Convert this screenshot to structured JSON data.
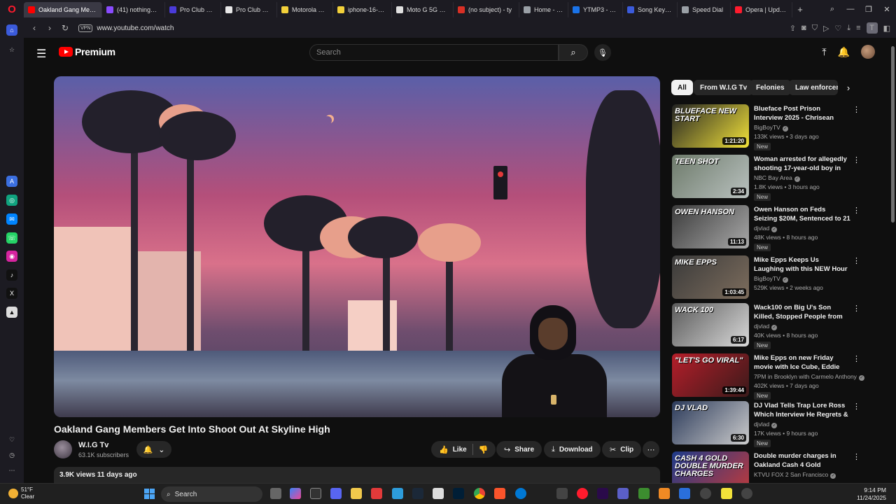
{
  "browser": {
    "tabs": [
      {
        "label": "Oakland Gang Memb",
        "color": "#ff0000",
        "active": true
      },
      {
        "label": "(41) nothingb4ik",
        "color": "#8a4bff"
      },
      {
        "label": "Pro Club Men's",
        "color": "#4a3bd9"
      },
      {
        "label": "Pro Club Men's",
        "color": "#e8e8e8"
      },
      {
        "label": "Motorola moto",
        "color": "#f2d03a"
      },
      {
        "label": "iphone-16-savin",
        "color": "#f2d03a"
      },
      {
        "label": "Moto G 5G NFC",
        "color": "#e0e0e0"
      },
      {
        "label": "(no subject) - ty",
        "color": "#d93025"
      },
      {
        "label": "Home - Google",
        "color": "#9aa0a6"
      },
      {
        "label": "YTMP3 - YouTub",
        "color": "#1a73e8"
      },
      {
        "label": "Song Key & BPM",
        "color": "#3b5bdb"
      },
      {
        "label": "Speed Dial",
        "color": "#9aa0a6"
      },
      {
        "label": "Opera | Update",
        "color": "#ff1b2d"
      }
    ],
    "vpn_label": "VPN",
    "url": "www.youtube.com/watch",
    "profile_letter": "T"
  },
  "youtube": {
    "logo_text": "Premium",
    "search_placeholder": "Search",
    "video": {
      "title": "Oakland Gang Members Get Into Shoot Out At Skyline High",
      "channel": "W.I.G Tv",
      "subscribers": "63.1K subscribers",
      "views_date": "3.9K views  11 days ago",
      "actions": {
        "like": "Like",
        "share": "Share",
        "download": "Download",
        "clip": "Clip"
      }
    },
    "chips": [
      "All",
      "From W.I.G Tv",
      "Felonies",
      "Law enforcem"
    ],
    "recommendations": [
      {
        "title": "Blueface Post Prison Interview 2025 - Chrisean Rock - ...",
        "channel": "BigBoyTV",
        "verified": true,
        "meta": "133K views • 3 days ago",
        "new": "New",
        "duration": "1:21:20",
        "thumb_text": "BLUEFACE NEW START",
        "thumb_colors": [
          "#222",
          "#f2e23a"
        ]
      },
      {
        "title": "Woman arrested for allegedly shooting 17-year-old boy in Sa...",
        "channel": "NBC Bay Area",
        "verified": true,
        "meta": "1.8K views • 3 hours ago",
        "new": "New",
        "duration": "2:34",
        "thumb_text": "TEEN SHOT",
        "thumb_colors": [
          "#6d7a6a",
          "#b9c1bf"
        ]
      },
      {
        "title": "Owen Hanson on Feds Seizing $20M, Sentenced to 21 Years I...",
        "channel": "djvlad",
        "verified": true,
        "meta": "48K views • 8 hours ago",
        "new": "New",
        "duration": "11:13",
        "thumb_text": "OWEN HANSON",
        "thumb_colors": [
          "#3b3b3b",
          "#a9a9a9"
        ]
      },
      {
        "title": "Mike Epps Keeps Us Laughing with this NEW Hour for 2025",
        "channel": "BigBoyTV",
        "verified": true,
        "meta": "529K views • 2 weeks ago",
        "new": "",
        "duration": "1:03:45",
        "thumb_text": "MIKE EPPS",
        "thumb_colors": [
          "#3a3a3a",
          "#7d6d5d"
        ]
      },
      {
        "title": "Wack100 on Big U's Son Killed, Stopped People from Killing ...",
        "channel": "djvlad",
        "verified": true,
        "meta": "40K views • 8 hours ago",
        "new": "New",
        "duration": "6:17",
        "thumb_text": "WACK 100",
        "thumb_colors": [
          "#5a5a5a",
          "#d9d9d9"
        ]
      },
      {
        "title": "Mike Epps on new Friday movie with Ice Cube, Eddie Murphy & ...",
        "channel": "7PM in Brooklyn with Carmelo Anthony",
        "verified": true,
        "meta": "402K views • 7 days ago",
        "new": "New",
        "duration": "1:39:44",
        "thumb_text": "\"LET'S GO VIRAL\"",
        "thumb_colors": [
          "#b51e2a",
          "#3a1a1a"
        ]
      },
      {
        "title": "DJ Vlad Tells Trap Lore Ross Which Interview He Regrets & ...",
        "channel": "djvlad",
        "verified": true,
        "meta": "17K views • 9 hours ago",
        "new": "New",
        "duration": "6:30",
        "thumb_text": "DJ VLAD",
        "thumb_colors": [
          "#2b3a5a",
          "#ccc"
        ]
      },
      {
        "title": "Double murder charges in Oakland Cash 4 Gold shooting...",
        "channel": "KTVU FOX 2 San Francisco",
        "verified": true,
        "meta": "",
        "new": "",
        "duration": "",
        "thumb_text": "CASH 4 GOLD DOUBLE MURDER CHARGES",
        "thumb_colors": [
          "#1d3b8a",
          "#c23a3a"
        ]
      }
    ]
  },
  "taskbar": {
    "weather_temp": "51°F",
    "weather_cond": "Clear",
    "search_label": "Search",
    "time": "9:14 PM",
    "date": "11/24/2025"
  }
}
